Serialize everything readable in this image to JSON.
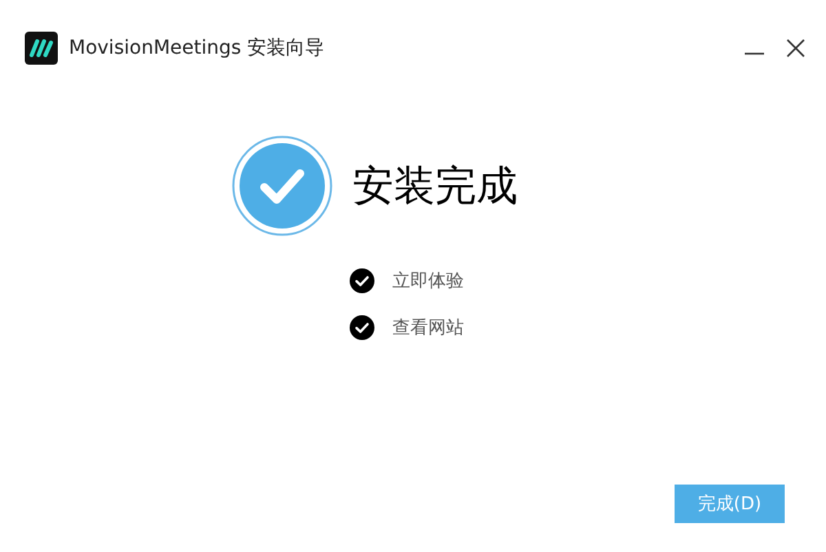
{
  "window": {
    "title": "MovisionMeetings 安装向导"
  },
  "heading": "安装完成",
  "options": [
    {
      "label": "立即体验",
      "checked": true
    },
    {
      "label": "查看网站",
      "checked": true
    }
  ],
  "buttons": [
    {
      "label": "完成(D)"
    }
  ]
}
